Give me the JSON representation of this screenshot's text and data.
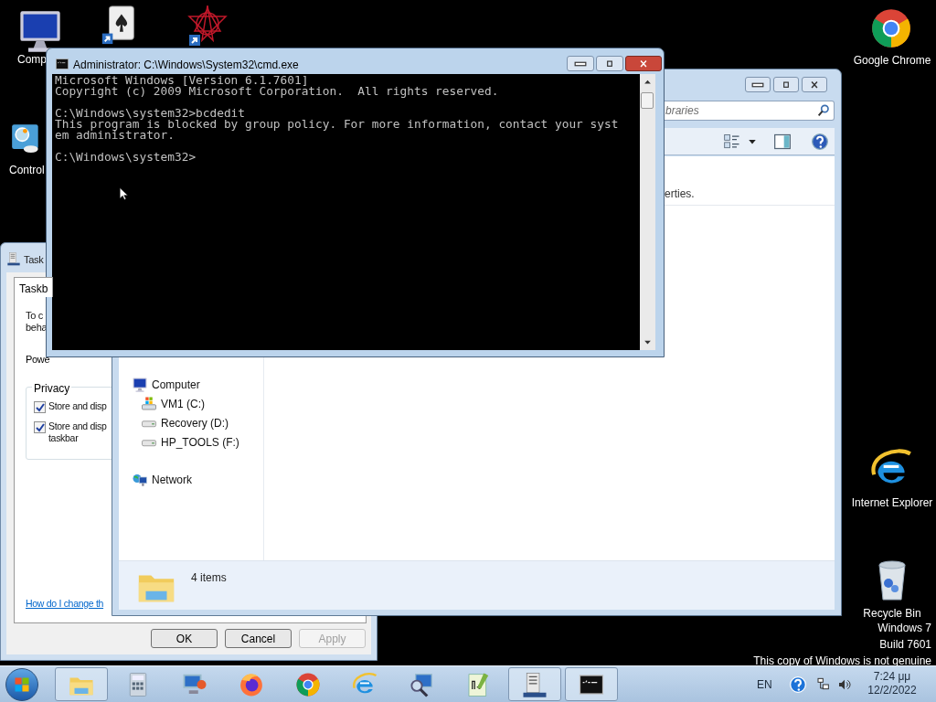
{
  "desktop_icons": [
    {
      "kind": "computer",
      "label": "Comp"
    },
    {
      "kind": "cards"
    },
    {
      "kind": "star"
    },
    {
      "kind": "control",
      "label": "Control"
    },
    {
      "kind": "chrome",
      "label": "Google Chrome"
    },
    {
      "kind": "ie",
      "label": "Internet Explorer"
    },
    {
      "kind": "recycle",
      "label": "Recycle Bin"
    }
  ],
  "taskbar_properties": {
    "title": "Task",
    "tabs": [
      {
        "label": "Taskb",
        "selected": true
      }
    ],
    "intro_lines": [
      "To c",
      "beha"
    ],
    "power_label": "Powe",
    "group": "Privacy",
    "checkboxes": [
      {
        "lines": [
          "Store and disp"
        ],
        "checked": true
      },
      {
        "lines": [
          "Store and disp",
          "taskbar"
        ],
        "checked": true
      }
    ],
    "help_link": "How do I change th",
    "buttons": [
      {
        "label": "OK",
        "disabled": false
      },
      {
        "label": "Cancel",
        "disabled": false
      },
      {
        "label": "Apply",
        "disabled": true
      }
    ]
  },
  "explorer": {
    "search": {
      "placeholder": "braries"
    },
    "details_text": "erties.",
    "nav": [
      {
        "label": "Computer",
        "kind": "computer",
        "children": [
          {
            "label": "VM1 (C:)",
            "kind": "system-drive"
          },
          {
            "label": "Recovery (D:)",
            "kind": "drive"
          },
          {
            "label": "HP_TOOLS (F:)",
            "kind": "drive"
          }
        ]
      },
      {
        "label": "Network",
        "kind": "network"
      }
    ],
    "status": "4 items"
  },
  "cmd_window": {
    "title": "Administrator: C:\\Windows\\System32\\cmd.exe",
    "blocks": [
      [
        "Microsoft Windows [Version 6.1.7601]",
        "Copyright (c) 2009 Microsoft Corporation.  All rights reserved."
      ],
      [
        "C:\\Windows\\system32>bcdedit",
        "This program is blocked by group policy. For more information, contact your syst",
        "em administrator."
      ],
      [
        "C:\\Windows\\system32>"
      ]
    ]
  },
  "watermark": [
    "Windows 7",
    "Build 7601",
    "This copy of Windows is not genuine"
  ],
  "taskbar": {
    "apps": [
      {
        "kind": "explorer",
        "active": true
      },
      {
        "kind": "calculator",
        "active": false
      },
      {
        "kind": "remote",
        "active": false
      },
      {
        "kind": "firefox",
        "active": false
      },
      {
        "kind": "chrome",
        "active": false
      },
      {
        "kind": "ie",
        "active": false
      },
      {
        "kind": "magnifier",
        "active": false
      },
      {
        "kind": "notepad",
        "active": false
      },
      {
        "kind": "taskprops",
        "active": true
      },
      {
        "kind": "cmd",
        "active": true
      }
    ],
    "language": "EN",
    "time": "7:24 μμ",
    "date": "12/2/2022"
  }
}
